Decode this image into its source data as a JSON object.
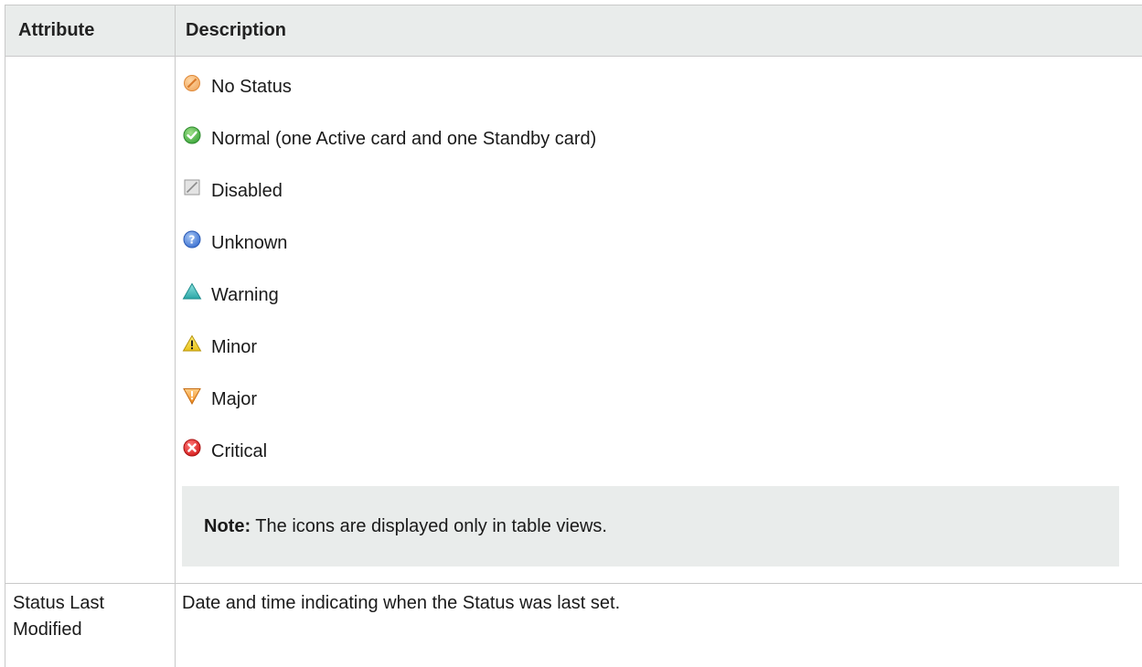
{
  "table": {
    "headers": {
      "attribute": "Attribute",
      "description": "Description"
    },
    "status_values": [
      {
        "icon": "no-status-icon",
        "label": "No Status"
      },
      {
        "icon": "normal-icon",
        "label": "Normal (one Active card and one Standby card)"
      },
      {
        "icon": "disabled-icon",
        "label": "Disabled"
      },
      {
        "icon": "unknown-icon",
        "label": "Unknown"
      },
      {
        "icon": "warning-icon",
        "label": "Warning"
      },
      {
        "icon": "minor-icon",
        "label": "Minor"
      },
      {
        "icon": "major-icon",
        "label": "Major"
      },
      {
        "icon": "critical-icon",
        "label": "Critical"
      }
    ],
    "note": {
      "label": "Note:",
      "text": " The icons are displayed only in table views."
    },
    "rows": [
      {
        "attribute": "Status Last Modified",
        "description": "Date and time indicating when the Status was last set."
      }
    ]
  },
  "colors": {
    "header_bg": "#e9eceb",
    "border": "#c9c9c9",
    "note_bg": "#e9eceb"
  }
}
